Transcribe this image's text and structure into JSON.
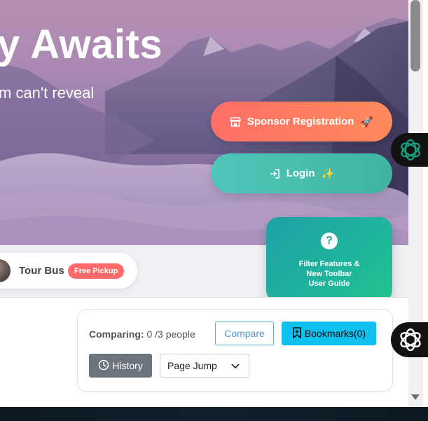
{
  "hero": {
    "title": "y Awaits",
    "subtitle": "m can't reveal"
  },
  "buttons": {
    "sponsor_label": "Sponsor Registration",
    "sponsor_emoji": "🚀",
    "login_label": "Login",
    "login_emoji": "✨"
  },
  "filter_card": {
    "icon_text": "?",
    "lines": [
      "Filter Features &",
      "New Toolbar",
      "User Guide"
    ]
  },
  "tour": {
    "label": "Tour Bus",
    "badge": "Free Pickup"
  },
  "compare_panel": {
    "comparing_label": "Comparing:",
    "count": "0",
    "capacity": "/3 people",
    "compare_button": "Compare",
    "bookmarks_button": "Bookmarks(0)",
    "history_button": "History",
    "page_jump": "Page Jump"
  },
  "colors": {
    "sponsor": "#ff7a62",
    "login": "#48bdae",
    "filter": "#1fb09f",
    "bookmarks": "#10c0ee",
    "history": "#6c757d",
    "badge": "#ff6b6b"
  },
  "icons": {
    "sponsor": "store-icon",
    "login": "login-arrow-icon",
    "filter": "question-circle-icon",
    "bookmarks": "bookmark-icon",
    "history": "clock-icon",
    "page_jump": "chevron-down-icon",
    "side_tab_1": "openai-icon",
    "side_tab_2": "openai-icon"
  }
}
